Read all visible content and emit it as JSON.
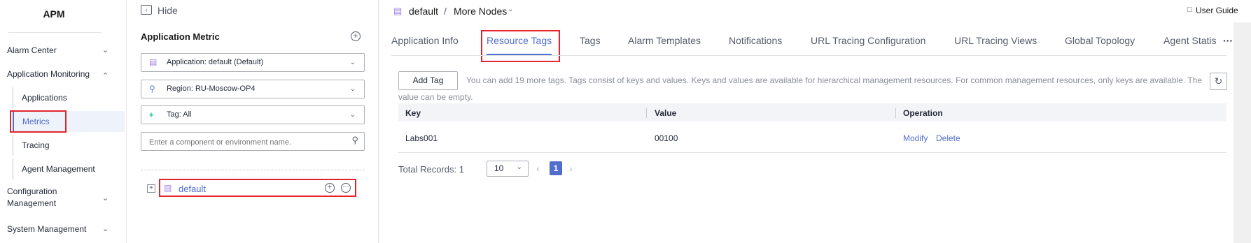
{
  "app": {
    "title": "APM"
  },
  "sidebar": {
    "items": [
      {
        "label": "Alarm Center"
      },
      {
        "label": "Application Monitoring"
      },
      {
        "label": "Applications"
      },
      {
        "label": "Metrics"
      },
      {
        "label": "Tracing"
      },
      {
        "label": "Agent Management"
      },
      {
        "label": "Configuration Management"
      },
      {
        "label": "System Management"
      }
    ]
  },
  "tree_panel": {
    "hide_label": "Hide",
    "title": "Application Metric",
    "application_filter": "Application:  default (Default)",
    "region_filter": "Region:  RU-Moscow-OP4",
    "tag_filter": "Tag:  All",
    "search_placeholder": "Enter a component or environment name.",
    "tree_node": "default"
  },
  "header": {
    "breadcrumb_root": "default",
    "breadcrumb_sep": "/",
    "breadcrumb_current": "More Nodes",
    "user_guide": "User Guide"
  },
  "tabs": [
    {
      "label": "Application Info"
    },
    {
      "label": "Resource Tags",
      "active": true
    },
    {
      "label": "Tags"
    },
    {
      "label": "Alarm Templates"
    },
    {
      "label": "Notifications"
    },
    {
      "label": "URL Tracing Configuration"
    },
    {
      "label": "URL Tracing Views"
    },
    {
      "label": "Global Topology"
    },
    {
      "label": "Agent Statis"
    }
  ],
  "tags_page": {
    "add_button": "Add Tag",
    "notice_line1": "You can add 19 more tags. Tags consist of keys and values. Keys and values are available for hierarchical management resources. For common management resources, only keys are available. The",
    "notice_line2": "value can be empty.",
    "columns": [
      "Key",
      "Value",
      "Operation"
    ],
    "rows": [
      {
        "key": "Labs001",
        "value": "00100",
        "actions": [
          "Modify",
          "Delete"
        ]
      }
    ],
    "total_label": "Total Records: 1",
    "page_size": "10",
    "current_page": "1"
  },
  "colors": {
    "accent": "#526ecc",
    "highlight": "#e4232d",
    "app_icon": "#a37ee6"
  }
}
